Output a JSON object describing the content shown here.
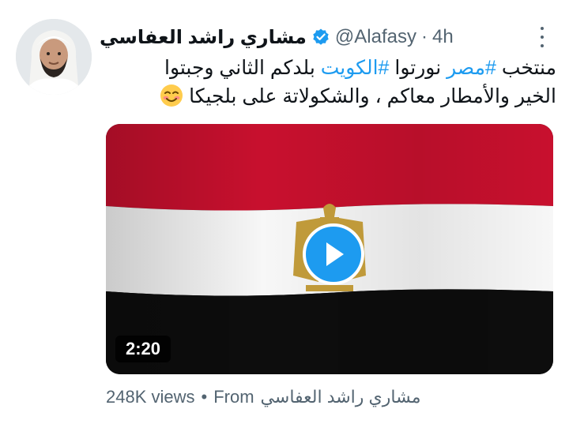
{
  "tweet": {
    "display_name": "مشاري راشد العفاسي",
    "handle": "@Alafasy",
    "separator": "·",
    "time": "4h",
    "text": {
      "part1": "منتخب ",
      "hashtag1": "#مصر",
      "part2": " نورتوا ",
      "hashtag2": "#الكويت",
      "part3": " بلدكم الثاني وجبتوا الخير والأمطار معاكم ، والشكولاتة على بلجيكا "
    },
    "emoji": "smiling-face-emoji"
  },
  "media": {
    "type": "video",
    "duration": "2:20",
    "flag_colors": {
      "top": "#c8102e",
      "middle": "#ffffff",
      "bottom": "#0d0d0d",
      "emblem": "#c09a3a"
    }
  },
  "footer": {
    "views": "248K views",
    "bullet": "•",
    "from_label": "From",
    "source": "مشاري راشد العفاسي"
  },
  "colors": {
    "accent": "#1d9bf0",
    "secondary_text": "#536471",
    "primary_text": "#0f1419"
  }
}
